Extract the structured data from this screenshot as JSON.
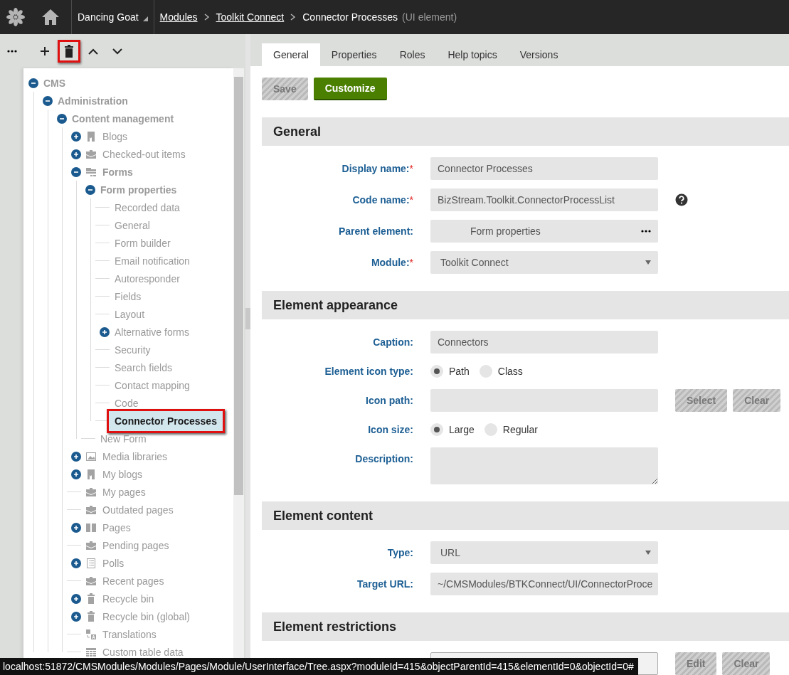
{
  "header": {
    "site": "Dancing Goat",
    "breadcrumbs": [
      {
        "label": "Modules",
        "kind": "link"
      },
      {
        "label": "Toolkit Connect",
        "kind": "link"
      },
      {
        "label": "Connector Processes",
        "kind": "current",
        "note": "(UI element)"
      }
    ]
  },
  "tree_toolbar": [
    {
      "kind": "add",
      "highlighted": false
    },
    {
      "kind": "delete",
      "highlighted": true
    },
    {
      "kind": "up",
      "highlighted": false
    },
    {
      "kind": "down",
      "highlighted": false
    }
  ],
  "tree": [
    {
      "label": "CMS",
      "expanded": true,
      "selected": false,
      "children": [
        {
          "label": "Administration",
          "expanded": true,
          "selected": false,
          "children": [
            {
              "label": "Content management",
              "expanded": true,
              "selected": false,
              "children": [
                {
                  "label": "Blogs",
                  "expanded": false,
                  "kind": "blog",
                  "selected": false
                },
                {
                  "label": "Checked-out items",
                  "expanded": false,
                  "kind": "briefcase",
                  "selected": false
                },
                {
                  "label": "Forms",
                  "expanded": true,
                  "kind": "forms",
                  "selected": false,
                  "children": [
                    {
                      "label": "Form properties",
                      "expanded": true,
                      "selected": false,
                      "children": [
                        {
                          "label": "Recorded data",
                          "selected": false
                        },
                        {
                          "label": "General",
                          "selected": false
                        },
                        {
                          "label": "Form builder",
                          "selected": false
                        },
                        {
                          "label": "Email notification",
                          "selected": false
                        },
                        {
                          "label": "Autoresponder",
                          "selected": false
                        },
                        {
                          "label": "Fields",
                          "selected": false
                        },
                        {
                          "label": "Layout",
                          "selected": false
                        },
                        {
                          "label": "Alternative forms",
                          "expanded": false,
                          "selected": false
                        },
                        {
                          "label": "Security",
                          "selected": false
                        },
                        {
                          "label": "Search fields",
                          "selected": false
                        },
                        {
                          "label": "Contact mapping",
                          "selected": false
                        },
                        {
                          "label": "Code",
                          "selected": false
                        },
                        {
                          "label": "Connector Processes",
                          "selected": true,
                          "highlighted": true
                        }
                      ]
                    },
                    {
                      "label": "New Form",
                      "selected": false
                    }
                  ]
                },
                {
                  "label": "Media libraries",
                  "expanded": false,
                  "kind": "media",
                  "selected": false
                },
                {
                  "label": "My blogs",
                  "expanded": false,
                  "kind": "blog",
                  "selected": false
                },
                {
                  "label": "My pages",
                  "kind": "briefcase",
                  "selected": false
                },
                {
                  "label": "Outdated pages",
                  "kind": "briefcase",
                  "selected": false
                },
                {
                  "label": "Pages",
                  "expanded": false,
                  "kind": "book",
                  "selected": false
                },
                {
                  "label": "Pending pages",
                  "kind": "briefcase",
                  "selected": false
                },
                {
                  "label": "Polls",
                  "expanded": false,
                  "kind": "poll",
                  "selected": false
                },
                {
                  "label": "Recent pages",
                  "kind": "briefcase",
                  "selected": false
                },
                {
                  "label": "Recycle bin",
                  "expanded": false,
                  "kind": "bin",
                  "selected": false
                },
                {
                  "label": "Recycle bin (global)",
                  "expanded": false,
                  "kind": "bin",
                  "selected": false
                },
                {
                  "label": "Translations",
                  "kind": "translate",
                  "selected": false
                },
                {
                  "label": "Custom table data",
                  "kind": "table",
                  "selected": false
                }
              ]
            }
          ]
        }
      ]
    }
  ],
  "tabs": [
    {
      "label": "General",
      "selected": true
    },
    {
      "label": "Properties",
      "selected": false
    },
    {
      "label": "Roles",
      "selected": false
    },
    {
      "label": "Help topics",
      "selected": false
    },
    {
      "label": "Versions",
      "selected": false
    }
  ],
  "actions": [
    {
      "label": "Save",
      "disabled": true,
      "kind": "plain"
    },
    {
      "label": "Customize",
      "disabled": false,
      "kind": "primary"
    }
  ],
  "sections": [
    {
      "title": "General",
      "fields": [
        {
          "label": "Display name:",
          "required_mark": "*",
          "kind": "text",
          "value": "Connector Processes"
        },
        {
          "label": "Code name:",
          "required_mark": "*",
          "kind": "text",
          "value": "BizStream.Toolkit.ConnectorProcessList",
          "help": true
        },
        {
          "label": "Parent element:",
          "kind": "picker",
          "value": "Form properties"
        },
        {
          "label": "Module:",
          "required_mark": "*",
          "kind": "select",
          "value": "Toolkit Connect"
        }
      ]
    },
    {
      "title": "Element appearance",
      "fields": [
        {
          "label": "Caption:",
          "kind": "text",
          "value": "Connectors"
        },
        {
          "label": "Element icon type:",
          "kind": "radio",
          "options": [
            {
              "label": "Path",
              "selected": true
            },
            {
              "label": "Class",
              "selected": false
            }
          ]
        },
        {
          "label": "Icon path:",
          "kind": "text",
          "buttons": [
            {
              "label": "Select",
              "disabled": true
            },
            {
              "label": "Clear",
              "disabled": true
            }
          ]
        },
        {
          "label": "Icon size:",
          "kind": "radio",
          "options": [
            {
              "label": "Large",
              "selected": true
            },
            {
              "label": "Regular",
              "selected": false
            }
          ]
        },
        {
          "label": "Description:",
          "kind": "textarea"
        }
      ]
    },
    {
      "title": "Element content",
      "fields": [
        {
          "label": "Type:",
          "kind": "select",
          "value": "URL"
        },
        {
          "label": "Target URL:",
          "kind": "text",
          "value": "~/CMSModules/BTKConnect/UI/ConnectorProce"
        }
      ]
    },
    {
      "title": "Element restrictions",
      "fields": [
        {
          "kind": "boxed",
          "buttons": [
            {
              "label": "Edit",
              "disabled": true
            },
            {
              "label": "Clear",
              "disabled": true
            }
          ]
        }
      ]
    }
  ],
  "status_bar": "localhost:51872/CMSModules/Modules/Pages/Module/UserInterface/Tree.aspx?moduleId=415&objectParentId=415&elementId=0&objectId=0#"
}
